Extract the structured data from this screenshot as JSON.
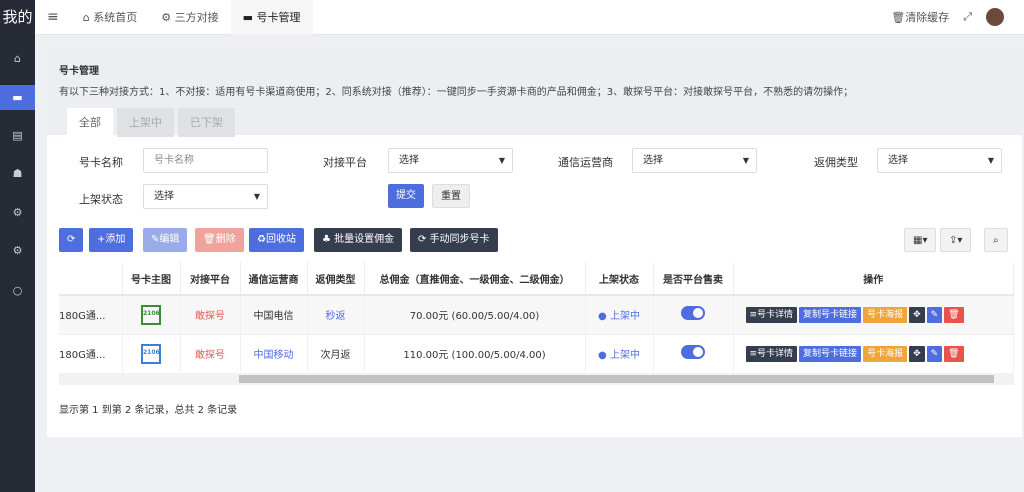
{
  "sidebar": {
    "logo": "我的",
    "items": [
      {
        "icon": "home-icon",
        "glyph": "⌂"
      },
      {
        "icon": "card-icon",
        "glyph": "▬",
        "active": true
      },
      {
        "icon": "file-icon",
        "glyph": "▤"
      },
      {
        "icon": "users-icon",
        "glyph": "☗"
      },
      {
        "icon": "gears-icon",
        "glyph": "⚙"
      },
      {
        "icon": "gears-icon",
        "glyph": "⚙"
      },
      {
        "icon": "circle-icon",
        "glyph": "○"
      }
    ]
  },
  "topbar": {
    "menu_glyph": "≡",
    "tabs": [
      {
        "label": "系统首页",
        "glyph": "⌂"
      },
      {
        "label": "三方对接",
        "glyph": "⚙"
      },
      {
        "label": "号卡管理",
        "glyph": "▬",
        "active": true
      }
    ],
    "clear_cache": "清除缓存",
    "fullscreen_glyph": "⤢"
  },
  "page": {
    "title": "号卡管理",
    "description": "有以下三种对接方式：1、不对接：适用有号卡渠道商使用；2、同系统对接（推荐）：一键同步一手资源卡商的产品和佣金；3、敢探号平台：对接敢探号平台，不熟悉的请勿操作；",
    "tabs": [
      "全部",
      "上架中",
      "已下架"
    ]
  },
  "filters": {
    "name_label": "号卡名称",
    "name_placeholder": "号卡名称",
    "platform_label": "对接平台",
    "platform_value": "选择",
    "operator_label": "通信运营商",
    "operator_value": "选择",
    "type_label": "返佣类型",
    "type_value": "选择",
    "status_label": "上架状态",
    "status_value": "选择",
    "submit": "提交",
    "reset": "重置"
  },
  "toolbar": {
    "refresh": "⟳",
    "add": "+添加",
    "edit": "✎编辑",
    "delete": "🗑删除",
    "recycle": "♻回收站",
    "batch": "批量设置佣金",
    "sync": "⟳ 手动同步号卡",
    "columns": "▦▾",
    "export": "⇪▾",
    "search": "⌕"
  },
  "colors": {
    "primary": "#4e6ee0",
    "dark": "#363d4f",
    "danger": "#e8534b",
    "warning": "#f0a53a"
  },
  "table": {
    "headers": [
      "",
      "号卡主图",
      "对接平台",
      "通信运营商",
      "返佣类型",
      "总佣金（直推佣金、一级佣金、二级佣金）",
      "上架状态",
      "是否平台售卖",
      "操作"
    ],
    "rows": [
      {
        "name": "180G通...",
        "img": "2106",
        "platform": "敢探号",
        "operator": "中国电信",
        "type": "秒返",
        "commission": "70.00元 (60.00/5.00/4.00)",
        "status": "● 上架中",
        "on_sale": true
      },
      {
        "name": "180G通...",
        "img": "2106",
        "platform": "敢探号",
        "operator": "中国移动",
        "type": "次月返",
        "commission": "110.00元 (100.00/5.00/4.00)",
        "status": "● 上架中",
        "on_sale": true
      }
    ],
    "actions": {
      "detail": "≡号卡详情",
      "copy": "复制号卡链接",
      "poster": "号卡海报",
      "move": "✥",
      "edit": "✎",
      "delete": "🗑"
    }
  },
  "footer": "显示第 1 到第 2 条记录，总共 2 条记录"
}
